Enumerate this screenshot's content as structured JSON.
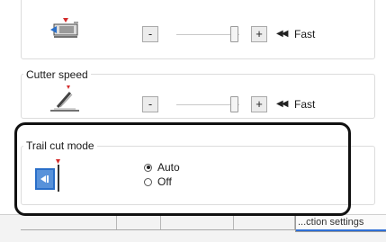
{
  "feed_speed": {
    "decrease_label": "-",
    "increase_label": "+",
    "speed_arrows": "◀◀",
    "speed_label": "Fast",
    "level": 1.0,
    "icon": "feed-motor-icon"
  },
  "cutter_speed": {
    "title": "Cutter speed",
    "decrease_label": "-",
    "increase_label": "+",
    "speed_arrows": "◀◀",
    "speed_label": "Fast",
    "level": 1.0,
    "icon": "cutter-blade-icon"
  },
  "trail_cut_mode": {
    "title": "Trail cut mode",
    "icon": "trail-cut-icon",
    "options": [
      {
        "label": "Auto",
        "selected": true
      },
      {
        "label": "Off",
        "selected": false
      }
    ]
  },
  "tabs": {
    "active_label": "...ction settings"
  },
  "colors": {
    "accent": "#2f6fd6",
    "icon_blue": "#2a6fc9",
    "icon_red": "#d42b2b"
  }
}
